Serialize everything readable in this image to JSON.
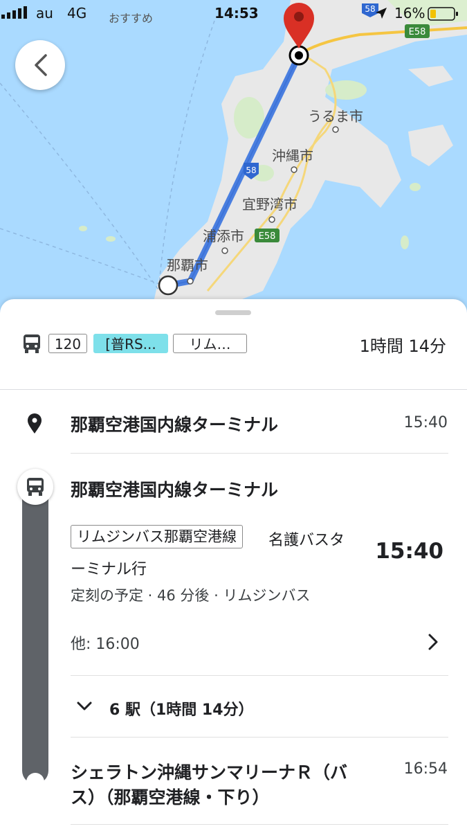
{
  "status_bar": {
    "carrier": "au",
    "network": "4G",
    "back_to_app": "おすすめ",
    "time": "14:53",
    "battery": "16%"
  },
  "map": {
    "cities": [
      "うるま市",
      "沖縄市",
      "宜野湾市",
      "浦添市",
      "那覇市"
    ],
    "road_58_a": "58",
    "road_58_b": "58",
    "road_e58_a": "E58",
    "road_e58_b": "E58",
    "route_color": "#4a7fe0",
    "sea_color": "#aadaff",
    "land_color": "#e8e8e8",
    "pin_color": "#d93025"
  },
  "summary": {
    "bus_number": "120",
    "chip_2": "[普RS...",
    "chip_3": "リム…",
    "duration": "1時間 14分"
  },
  "origin": {
    "name": "那覇空港国内線ターミナル",
    "time": "15:40"
  },
  "transit": {
    "stop_name": "那覇空港国内線ターミナル",
    "line_badge": "リムジンバス那覇空港線",
    "headsign_1": "名護バスタ",
    "headsign_2": "ーミナル行",
    "departure_time": "15:40",
    "schedule_info": "定刻の予定 · 46 分後 · リムジンバス",
    "other_times": "他: 16:00",
    "stops_summary": "6 駅（1時間 14分）",
    "arrival_name_1": "シェラトン沖縄サンマリーナＲ（バ",
    "arrival_name_2": "ス）（那覇空港線・下り）",
    "arrival_time": "16:54"
  }
}
